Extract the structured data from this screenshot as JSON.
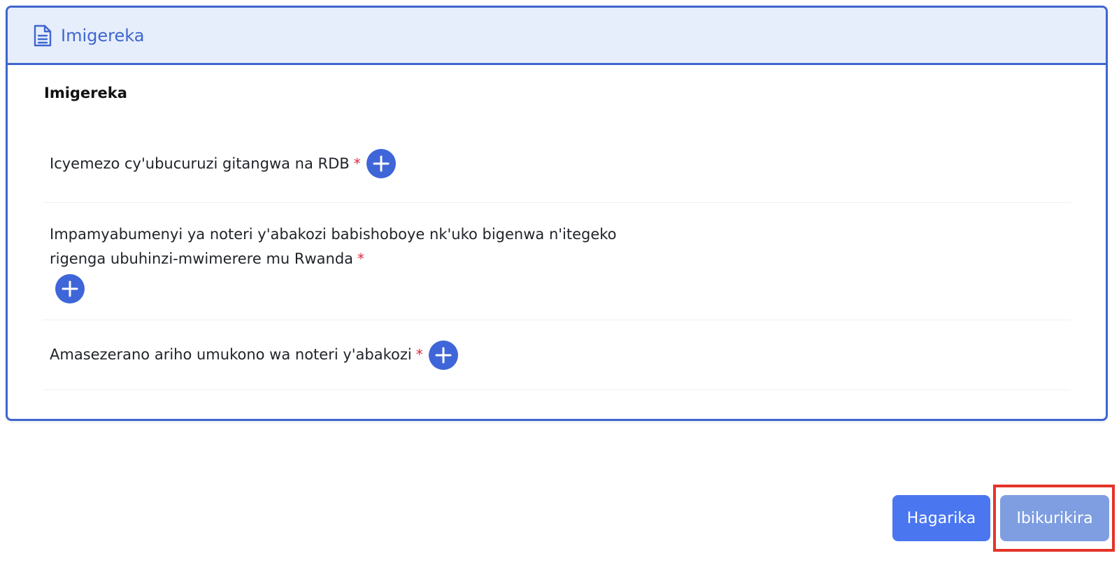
{
  "header": {
    "title": "Imigereka",
    "icon": "document-icon"
  },
  "section": {
    "title": "Imigereka"
  },
  "documents": [
    {
      "label": "Icyemezo cy'ubucuruzi gitangwa na RDB",
      "required_mark": "*"
    },
    {
      "label": "Impamyabumenyi ya noteri y'abakozi babishoboye nk'uko bigenwa n'itegeko rigenga ubuhinzi-mwimerere mu Rwanda",
      "required_mark": "*"
    },
    {
      "label": "Amasezerano ariho umukono wa noteri y'abakozi",
      "required_mark": "*"
    }
  ],
  "footer": {
    "cancel_label": "Hagarika",
    "next_label": "Ibikurikira"
  },
  "colors": {
    "accent": "#3f66cf",
    "header_bg": "#e6eefb",
    "required": "#e0283c",
    "cancel_button": "#4a76f0",
    "next_button": "#7f9ee1",
    "highlight": "#e53329"
  }
}
